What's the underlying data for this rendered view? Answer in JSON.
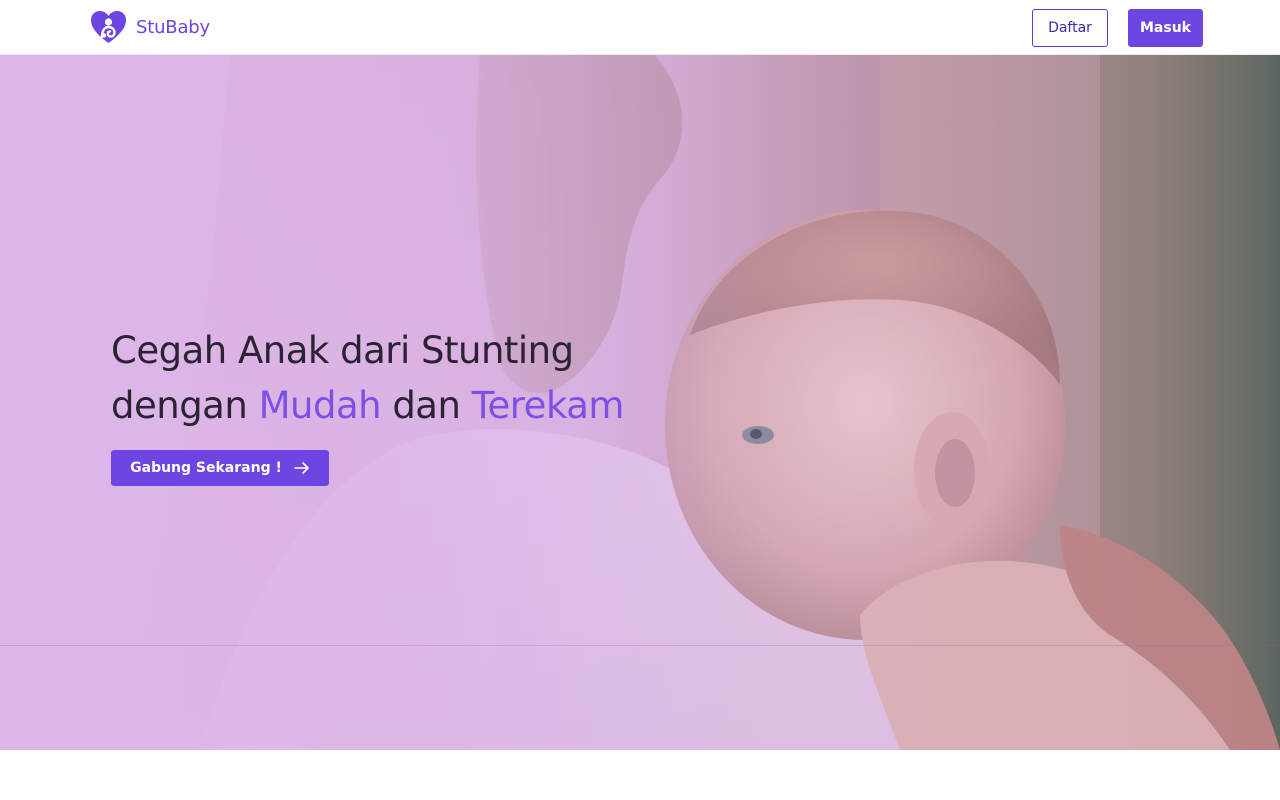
{
  "navbar": {
    "brand_name": "StuBaby",
    "register_label": "Daftar",
    "login_label": "Masuk"
  },
  "hero": {
    "headline_line1": "Cegah Anak dari Stunting",
    "headline_line2_prefix": "dengan ",
    "headline_accent1": "Mudah",
    "headline_line2_middle": " dan ",
    "headline_accent2": "Terekam",
    "cta_label": "Gabung Sekarang !",
    "cta_icon": "arrow-right-icon",
    "image_subject": "mother holding baby"
  },
  "colors": {
    "brand": "#6d45e2",
    "accent_text": "#7c4fe6",
    "headline": "#2b2233",
    "hero_tint": "#dcb6e8"
  }
}
